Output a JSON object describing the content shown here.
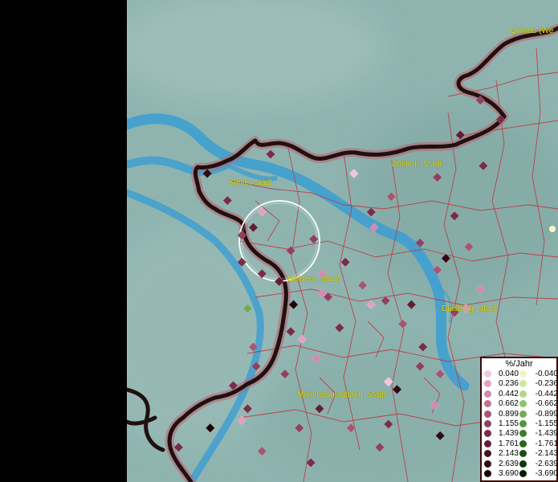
{
  "map": {
    "colors": {
      "background": "#8fb4b0",
      "river": "#3f9fd0",
      "border": "#201010",
      "district": "#c0303a",
      "label": "#e8e000",
      "focus_ring": "#ffffff"
    },
    "cities": [
      {
        "id": "gronau",
        "label": "Gronau (We"
      },
      {
        "id": "bocholt",
        "label": "Bocholt, Stadt"
      },
      {
        "id": "kleve",
        "label": "Kleve, Stadt"
      },
      {
        "id": "geldern",
        "label": "Geldern, Stadt"
      },
      {
        "id": "duisburg",
        "label": "Duisburg, Stadt"
      },
      {
        "id": "moenchengladbach",
        "label": "Mönchengladbach, Stadt"
      }
    ]
  },
  "legend": {
    "title": "%/Jahr",
    "positive": [
      {
        "value": "0.040",
        "color": "#f3c4e2"
      },
      {
        "value": "0.236",
        "color": "#e4a0c4"
      },
      {
        "value": "0.442",
        "color": "#d28ab0"
      },
      {
        "value": "0.662",
        "color": "#c07094"
      },
      {
        "value": "0.899",
        "color": "#a85574"
      },
      {
        "value": "1.155",
        "color": "#904060"
      },
      {
        "value": "1.439",
        "color": "#782d48"
      },
      {
        "value": "1.761",
        "color": "#621e36"
      },
      {
        "value": "2.143",
        "color": "#4a1024"
      },
      {
        "value": "2.639",
        "color": "#320814"
      },
      {
        "value": "3.690",
        "color": "#1a0208"
      }
    ],
    "negative": [
      {
        "value": "-0.040",
        "color": "#f2f4c6"
      },
      {
        "value": "-0.236",
        "color": "#cfe6a6"
      },
      {
        "value": "-0.442",
        "color": "#b2d88c"
      },
      {
        "value": "-0.662",
        "color": "#8fc46c"
      },
      {
        "value": "-0.899",
        "color": "#6fae50"
      },
      {
        "value": "-1.155",
        "color": "#529638"
      },
      {
        "value": "-1.439",
        "color": "#3a7e28"
      },
      {
        "value": "-1.761",
        "color": "#28661c"
      },
      {
        "value": "-2.143",
        "color": "#1a4e12"
      },
      {
        "value": "-2.639",
        "color": "#0e380a"
      },
      {
        "value": "-3.690",
        "color": "#041e02"
      }
    ]
  },
  "points": [
    {
      "v": 1.44,
      "lng": 6.2,
      "lat": 51.85
    },
    {
      "v": 2.64,
      "lng": 5.98,
      "lat": 51.8
    },
    {
      "v": 1.76,
      "lng": 6.05,
      "lat": 51.73
    },
    {
      "v": 0.44,
      "lng": 6.17,
      "lat": 51.7
    },
    {
      "v": 1.16,
      "lng": 6.1,
      "lat": 51.64
    },
    {
      "v": 2.14,
      "lng": 6.14,
      "lat": 51.66
    },
    {
      "v": 1.76,
      "lng": 6.1,
      "lat": 51.57
    },
    {
      "v": 1.44,
      "lng": 6.17,
      "lat": 51.54
    },
    {
      "v": 1.16,
      "lng": 6.27,
      "lat": 51.6
    },
    {
      "v": 0.04,
      "lng": 6.49,
      "lat": 51.8
    },
    {
      "v": 0.9,
      "lng": 6.62,
      "lat": 51.74
    },
    {
      "v": 1.16,
      "lng": 6.78,
      "lat": 51.79
    },
    {
      "v": 1.76,
      "lng": 6.94,
      "lat": 51.82
    },
    {
      "v": 1.44,
      "lng": 7.0,
      "lat": 51.94
    },
    {
      "v": 1.16,
      "lng": 6.93,
      "lat": 51.99
    },
    {
      "v": 2.14,
      "lng": 6.86,
      "lat": 51.9
    },
    {
      "v": 1.44,
      "lng": 6.84,
      "lat": 51.69
    },
    {
      "v": 0.9,
      "lng": 6.89,
      "lat": 51.61
    },
    {
      "v": 1.16,
      "lng": 6.72,
      "lat": 51.62
    },
    {
      "v": 2.64,
      "lng": 6.81,
      "lat": 51.58
    },
    {
      "v": 0.66,
      "lng": 6.56,
      "lat": 51.66
    },
    {
      "v": 1.76,
      "lng": 6.55,
      "lat": 51.7
    },
    {
      "v": 1.16,
      "lng": 6.35,
      "lat": 51.63
    },
    {
      "v": 0.66,
      "lng": 6.38,
      "lat": 51.54
    },
    {
      "v": 1.44,
      "lng": 6.46,
      "lat": 51.57
    },
    {
      "v": 0.9,
      "lng": 6.52,
      "lat": 51.51
    },
    {
      "v": 1.16,
      "lng": 6.4,
      "lat": 51.48
    },
    {
      "v": 2.14,
      "lng": 6.23,
      "lat": 51.52
    },
    {
      "v": 3.69,
      "lng": 6.28,
      "lat": 51.46
    },
    {
      "v": -0.9,
      "lng": 6.12,
      "lat": 51.45
    },
    {
      "v": 0.66,
      "lng": 6.38,
      "lat": 51.49
    },
    {
      "v": 1.44,
      "lng": 6.44,
      "lat": 51.4
    },
    {
      "v": 1.16,
      "lng": 6.6,
      "lat": 51.47
    },
    {
      "v": 0.9,
      "lng": 6.66,
      "lat": 51.41
    },
    {
      "v": 1.76,
      "lng": 6.73,
      "lat": 51.35
    },
    {
      "v": 0.44,
      "lng": 6.88,
      "lat": 51.45
    },
    {
      "v": 0.66,
      "lng": 6.93,
      "lat": 51.5
    },
    {
      "v": 0.9,
      "lng": 6.78,
      "lat": 51.55
    },
    {
      "v": 1.16,
      "lng": 6.84,
      "lat": 51.44
    },
    {
      "v": 2.14,
      "lng": 6.69,
      "lat": 51.46
    },
    {
      "v": 0.44,
      "lng": 6.55,
      "lat": 51.46
    },
    {
      "v": 1.44,
      "lng": 6.27,
      "lat": 51.39
    },
    {
      "v": 0.9,
      "lng": 6.14,
      "lat": 51.35
    },
    {
      "v": 1.16,
      "lng": 6.15,
      "lat": 51.3
    },
    {
      "v": 0.44,
      "lng": 6.31,
      "lat": 51.37
    },
    {
      "v": 0.66,
      "lng": 6.36,
      "lat": 51.32
    },
    {
      "v": 1.16,
      "lng": 6.25,
      "lat": 51.28
    },
    {
      "v": 1.44,
      "lng": 6.07,
      "lat": 51.25
    },
    {
      "v": 0.04,
      "lng": 6.61,
      "lat": 51.26
    },
    {
      "v": 2.64,
      "lng": 6.64,
      "lat": 51.24
    },
    {
      "v": 1.16,
      "lng": 6.72,
      "lat": 51.3
    },
    {
      "v": 0.9,
      "lng": 6.79,
      "lat": 51.28
    },
    {
      "v": 1.76,
      "lng": 6.12,
      "lat": 51.19
    },
    {
      "v": 0.44,
      "lng": 6.1,
      "lat": 51.16
    },
    {
      "v": 3.69,
      "lng": 5.99,
      "lat": 51.14
    },
    {
      "v": 1.16,
      "lng": 6.3,
      "lat": 51.14
    },
    {
      "v": 2.14,
      "lng": 6.37,
      "lat": 51.19
    },
    {
      "v": 0.9,
      "lng": 6.48,
      "lat": 51.14
    },
    {
      "v": 1.44,
      "lng": 6.61,
      "lat": 51.15
    },
    {
      "v": 0.66,
      "lng": 6.77,
      "lat": 51.2
    },
    {
      "v": 1.16,
      "lng": 6.58,
      "lat": 51.09
    },
    {
      "v": 2.64,
      "lng": 6.79,
      "lat": 51.12
    },
    {
      "v": 1.76,
      "lng": 5.88,
      "lat": 51.09
    },
    {
      "v": 0.9,
      "lng": 6.17,
      "lat": 51.08
    },
    {
      "v": 1.44,
      "lng": 6.34,
      "lat": 51.05
    }
  ]
}
